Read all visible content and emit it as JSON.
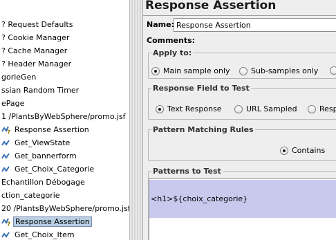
{
  "tree": {
    "items": [
      {
        "label": "? Request Defaults",
        "icon": "none"
      },
      {
        "label": "? Cookie Manager",
        "icon": "none"
      },
      {
        "label": "? Cache Manager",
        "icon": "none"
      },
      {
        "label": "? Header Manager",
        "icon": "none"
      },
      {
        "label": "gorieGen",
        "icon": "none"
      },
      {
        "label": "ssian Random Timer",
        "icon": "none"
      },
      {
        "label": "ePage",
        "icon": "none"
      },
      {
        "label": "1 /PlantsByWebSphere/promo.jsf",
        "icon": "none"
      },
      {
        "label": "Response Assertion",
        "icon": "assertion-icon"
      },
      {
        "label": "Get_ViewState",
        "icon": "extractor-icon"
      },
      {
        "label": "Get_bannerform",
        "icon": "extractor-icon"
      },
      {
        "label": "Get_Choix_Categorie",
        "icon": "extractor-icon"
      },
      {
        "label": "Echantillon Débogage",
        "icon": "none"
      },
      {
        "label": "ction_categorie",
        "icon": "none"
      },
      {
        "label": "20 /PlantsByWebSphere/promo.jsf",
        "icon": "none"
      },
      {
        "label": "Response Assertion",
        "icon": "assertion-icon",
        "selected": true
      },
      {
        "label": "Get_Choix_Item",
        "icon": "extractor-icon"
      }
    ]
  },
  "panel": {
    "title": "Response Assertion",
    "name_label": "Name:",
    "name_value": "Response Assertion",
    "comments_label": "Comments:",
    "apply_to": {
      "title": "Apply to:",
      "options": [
        "Main sample only",
        "Sub-samples only",
        ""
      ],
      "selected": "Main sample only"
    },
    "response_field": {
      "title": "Response Field to Test",
      "options": [
        "Text Response",
        "URL Sampled",
        "Resp"
      ],
      "selected": "Text Response"
    },
    "pattern_rules": {
      "title": "Pattern Matching Rules",
      "options": [
        "Contains"
      ],
      "selected": "Contains"
    },
    "patterns": {
      "title": "Patterns to Test",
      "rows": [
        "<h1>${choix_categorie}"
      ]
    }
  },
  "colors": {
    "selection": "#b8cfe5",
    "pattern_row": "#c9c9ee",
    "panel_bg": "#eeeeee"
  }
}
